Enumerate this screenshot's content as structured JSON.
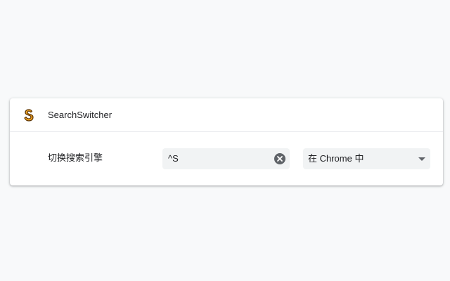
{
  "extension": {
    "name": "SearchSwitcher",
    "logo_icon": "s-logo-icon",
    "logo_fill": "#f5a623",
    "logo_stroke": "#5a3200"
  },
  "command": {
    "label": "切换搜索引擎",
    "shortcut": "^S",
    "clear_icon": "clear-circle-icon",
    "scope": {
      "selected": "在 Chrome 中"
    }
  },
  "colors": {
    "background": "#f8f9fa",
    "card": "#ffffff",
    "field": "#f1f3f4",
    "text": "#202124",
    "icon": "#5f6368"
  }
}
